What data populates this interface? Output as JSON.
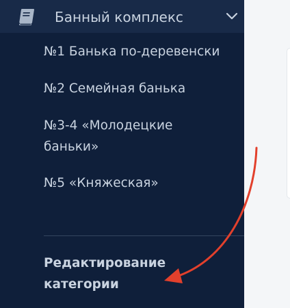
{
  "sidebar": {
    "header": {
      "label": "Банный комплекс",
      "icon": "book-icon",
      "expand_icon": "chevron-down-icon"
    },
    "items": [
      {
        "label": "№1 Банька по-деревенски"
      },
      {
        "label": "№2 Семейная банька"
      },
      {
        "label": "№3-4 «Молодецкие баньки»"
      },
      {
        "label": "№5 «Княжеская»"
      }
    ],
    "edit_category": {
      "label": "Редактирование категории"
    }
  },
  "colors": {
    "sidebar_bg": "#0f1f3a",
    "header_bg": "#182a48",
    "text": "#c9d3e0",
    "arrow": "#e2402c"
  }
}
